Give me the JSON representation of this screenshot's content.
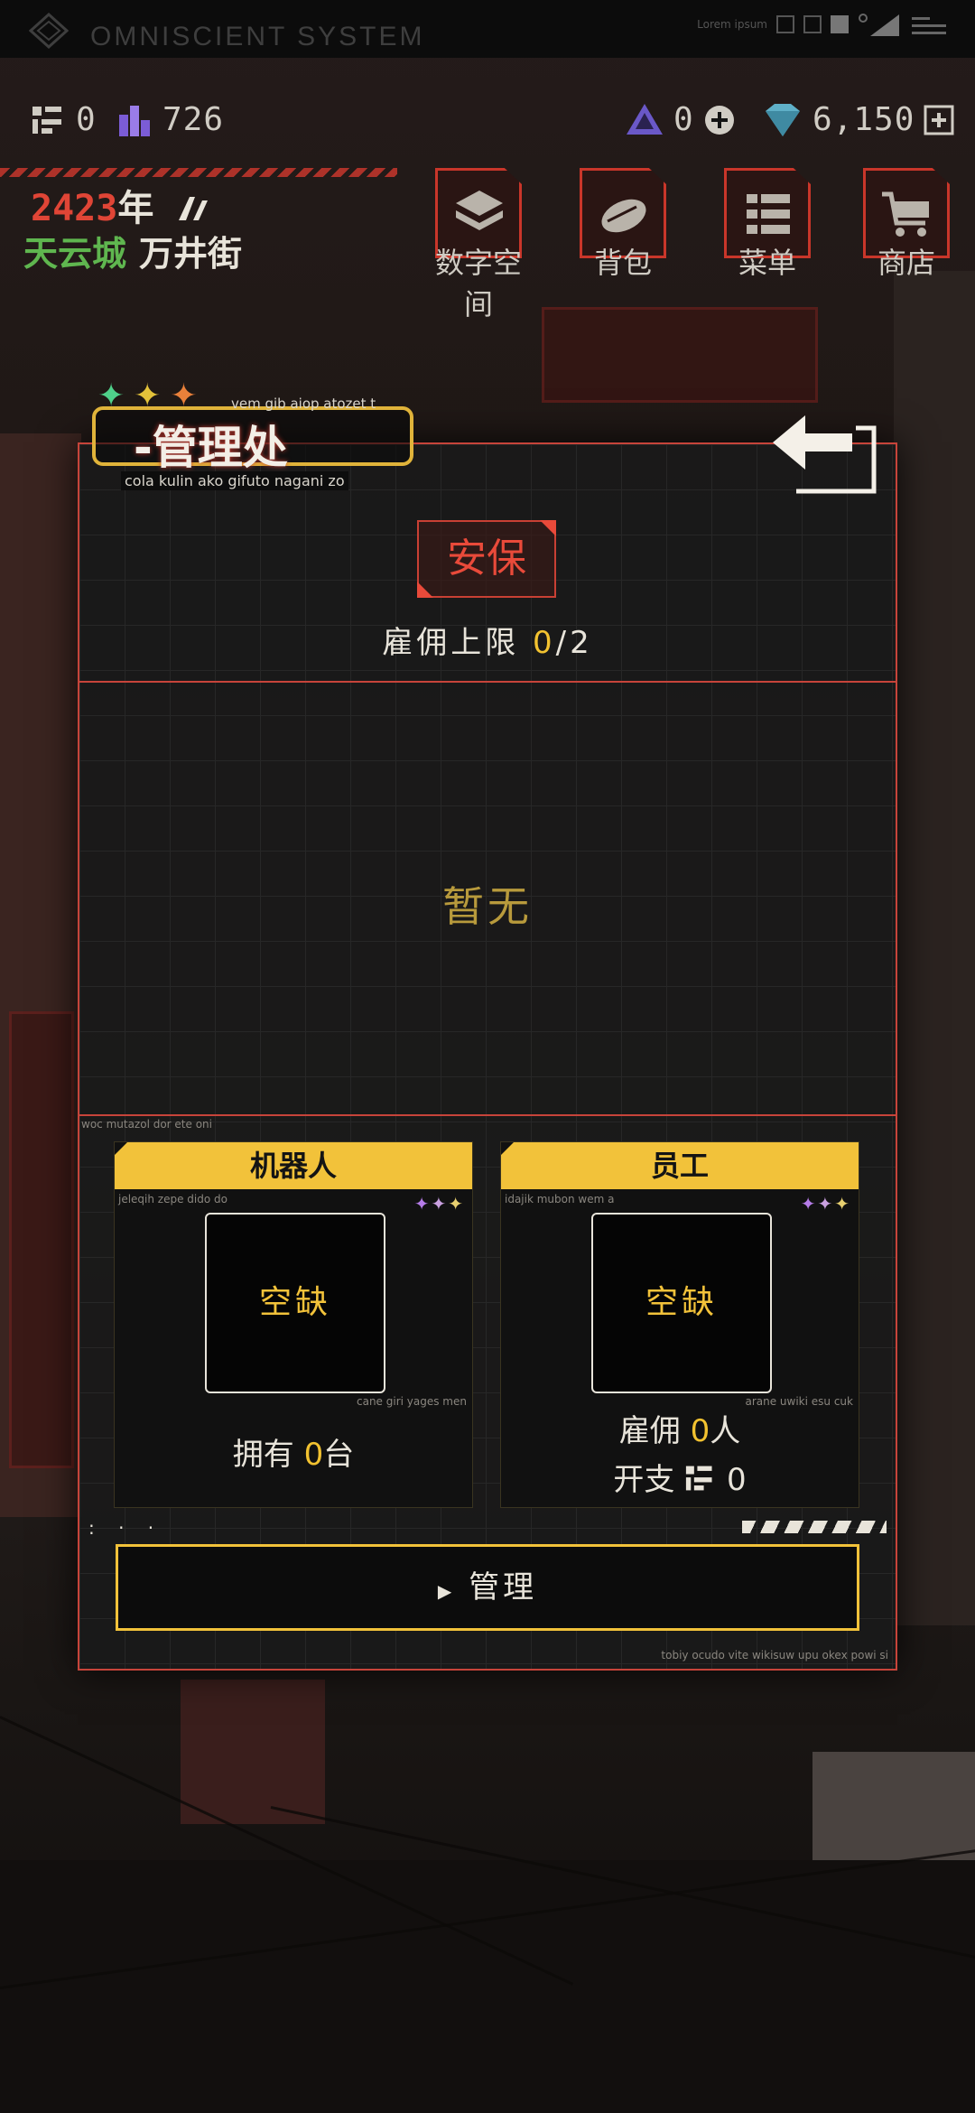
{
  "system": {
    "title": "OMNISCIENT SYSTEM",
    "small_text": "Lorem ipsum"
  },
  "resources": {
    "chips": "0",
    "energy": "726",
    "crystal": "0",
    "diamond": "6,150"
  },
  "date": {
    "year": "2423",
    "year_suffix": "年"
  },
  "location": {
    "city": "天云城",
    "street": "万井街"
  },
  "nav": [
    {
      "label": "数字空间",
      "icon": "cube-icon"
    },
    {
      "label": "背包",
      "icon": "bag-icon"
    },
    {
      "label": "菜单",
      "icon": "menu-icon"
    },
    {
      "label": "商店",
      "icon": "cart-icon"
    }
  ],
  "panel": {
    "title": "-管理处",
    "title_sub_top": "vem gib aiop atozet t",
    "title_sub_bottom": "cola kulin ako gifuto nagani zo",
    "stars": [
      "✦",
      "✦",
      "✦"
    ],
    "security_label": "安保",
    "hire_limit_label": "雇佣上限",
    "hire_current": "0",
    "hire_max": "/2",
    "empty_label": "暂无",
    "tiny_section": "woc mutazol dor ete oni",
    "tiny_footer": "tobiy ocudo vite wikisuw upu okex powi si",
    "manage_button": "管理"
  },
  "cards": {
    "robot": {
      "title": "机器人",
      "tiny_top": "jeleqih zepe dido do",
      "tiny_bottom": "cane giri yages men",
      "slot": "空缺",
      "own_label": "拥有",
      "own_count": "0",
      "own_unit": "台"
    },
    "staff": {
      "title": "员工",
      "tiny_top": "idajik mubon wem a",
      "tiny_bottom": "arane uwiki esu cuk",
      "slot": "空缺",
      "hire_label": "雇佣",
      "hire_count": "0",
      "hire_unit": "人",
      "cost_label": "开支",
      "cost_value": "0"
    }
  },
  "colors": {
    "accent_red": "#c7443a",
    "accent_yellow": "#f2c23a",
    "city_green": "#5fb64f"
  }
}
